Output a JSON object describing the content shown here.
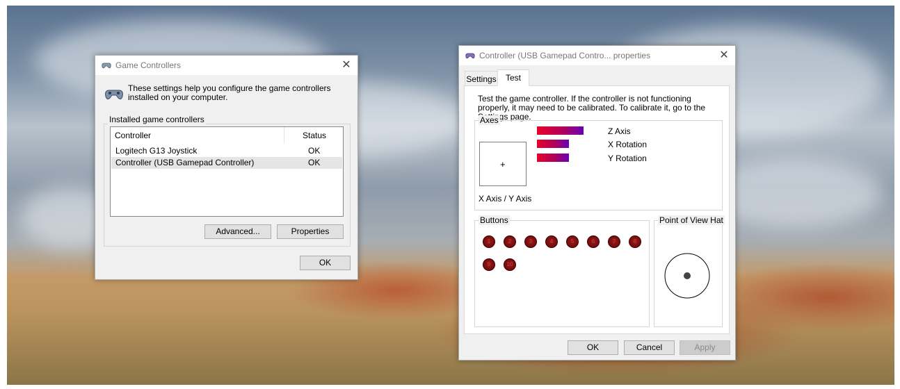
{
  "colors": {
    "bar_start": "#e8002a",
    "bar_end": "#6a00b8",
    "button_led": "#7a0e0e"
  },
  "game_controllers": {
    "title": "Game Controllers",
    "icon": "gamepad-icon",
    "description": "These settings help you configure the game controllers installed on your computer.",
    "group_label": "Installed game controllers",
    "columns": [
      "Controller",
      "Status"
    ],
    "rows": [
      {
        "controller": "Logitech G13 Joystick",
        "status": "OK",
        "selected": false
      },
      {
        "controller": "Controller (USB Gamepad Controller)",
        "status": "OK",
        "selected": true
      }
    ],
    "advanced_label": "Advanced...",
    "properties_label": "Properties",
    "ok_label": "OK"
  },
  "properties": {
    "title": "Controller (USB Gamepad Contro... properties",
    "icon": "gamepad-icon",
    "tabs": [
      {
        "label": "Settings",
        "active": false
      },
      {
        "label": "Test",
        "active": true
      }
    ],
    "intro": "Test the game controller.  If the controller is not functioning properly, it may need to be calibrated.  To calibrate it, go to the Settings page.",
    "axes": {
      "label": "Axes",
      "xy_label": "X Axis / Y Axis",
      "crosshair": "+",
      "bars": [
        {
          "label": "Z Axis",
          "level": 1.0
        },
        {
          "label": "X Rotation",
          "level": 0.68
        },
        {
          "label": "Y Rotation",
          "level": 0.68
        }
      ]
    },
    "buttons": {
      "label": "Buttons",
      "items": [
        "1",
        "2",
        "3",
        "4",
        "5",
        "6",
        "7",
        "8",
        "9",
        "10"
      ]
    },
    "pov": {
      "label": "Point of View Hat"
    },
    "ok_label": "OK",
    "cancel_label": "Cancel",
    "apply_label": "Apply"
  }
}
